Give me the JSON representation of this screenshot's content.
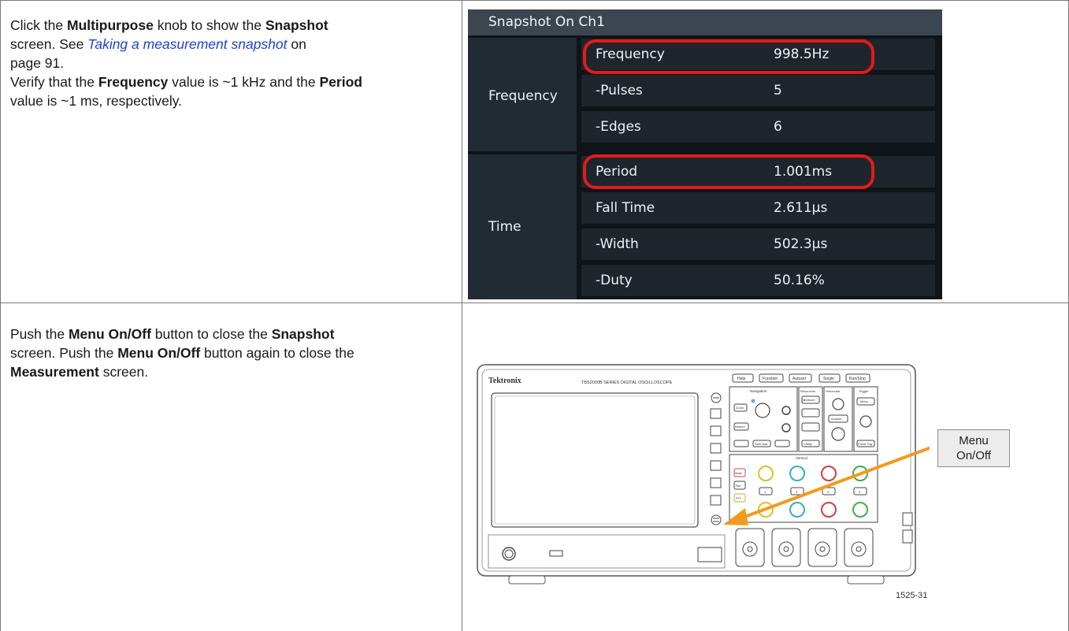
{
  "row1": {
    "line1": {
      "t1": "Click the ",
      "b1": "Multipurpose",
      "t2": " knob to show the ",
      "b2": "Snapshot"
    },
    "line2": {
      "t1": "screen. See ",
      "link": "Taking a measurement snapshot",
      "t2": " on"
    },
    "line3": {
      "t1": "page 91."
    },
    "line4": {
      "t1": "Verify that the ",
      "b1": "Frequency",
      "t2": " value is ~1 kHz and the ",
      "b2": "Period"
    },
    "line5": {
      "t1": "value is ~1 ms, respectively."
    }
  },
  "snapshot": {
    "title": "Snapshot On Ch1",
    "groups": [
      {
        "label": "Frequency",
        "rows": [
          {
            "name": "Frequency",
            "value": "998.5Hz",
            "highlighted": true
          },
          {
            "name": "-Pulses",
            "value": "5"
          },
          {
            "name": "-Edges",
            "value": "6"
          }
        ]
      },
      {
        "label": "Time",
        "rows": [
          {
            "name": "Period",
            "value": "1.001ms",
            "highlighted": true
          },
          {
            "name": "Fall Time",
            "value": "2.611µs"
          },
          {
            "name": "-Width",
            "value": "502.3µs"
          },
          {
            "name": "-Duty",
            "value": "50.16%"
          }
        ]
      }
    ],
    "highlight_color": "#e31a1a"
  },
  "row2": {
    "line1": {
      "t1": "Push the ",
      "b1": "Menu On/Off",
      "t2": " button to close the ",
      "b2": "Snapshot"
    },
    "line2": {
      "t1": "screen. Push the ",
      "b1": "Menu On/Off",
      "t2": " button again to close the"
    },
    "line3": {
      "b1": "Measurement",
      "t1": " screen."
    }
  },
  "scope": {
    "brand": "Tektronix",
    "model": "TBS2000B SERIES DIGITAL OSCILLOSCOPE",
    "front_buttons": [
      "Help",
      "Function",
      "Autoset",
      "Single",
      "Run/Stop"
    ],
    "section_labels": [
      "Navigation",
      "Resources",
      "Horizontal",
      "Trigger",
      "Vertical"
    ],
    "panel_buttons": [
      "Zoom",
      "Search",
      "Measure",
      "Cursor",
      "Save Recall",
      "Acquire",
      "Default Setup",
      "Utility",
      "Menu",
      "Force Trig",
      "Math",
      "Ref",
      "FFT",
      "Set/Clear"
    ],
    "channel_buttons": [
      "1",
      "2",
      "3",
      "4"
    ],
    "callout": "Menu On/Off",
    "callout_line1": "Menu",
    "callout_line2": "On/Off",
    "figure_id": "1525-31",
    "arrow_color": "#f29a1f"
  }
}
